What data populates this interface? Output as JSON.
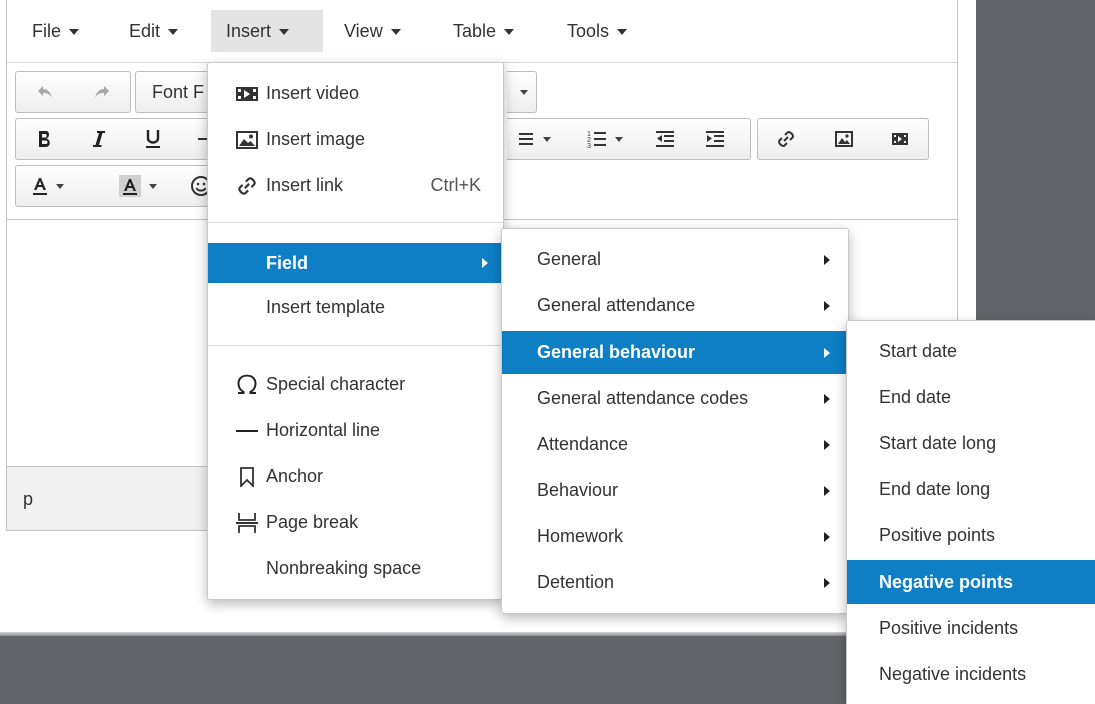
{
  "menubar": {
    "items": [
      {
        "label": "File"
      },
      {
        "label": "Edit"
      },
      {
        "label": "Insert"
      },
      {
        "label": "View"
      },
      {
        "label": "Table"
      },
      {
        "label": "Tools"
      }
    ]
  },
  "toolbar": {
    "font_label": "Font F"
  },
  "statusbar": {
    "path": "p"
  },
  "insert_menu": {
    "items": [
      {
        "label": "Insert video",
        "icon": "video-icon"
      },
      {
        "label": "Insert image",
        "icon": "image-icon"
      },
      {
        "label": "Insert link",
        "icon": "link-icon",
        "shortcut": "Ctrl+K"
      },
      {
        "label": "Field",
        "highlighted": true,
        "submenu": true
      },
      {
        "label": "Insert template"
      },
      {
        "label": "Special character",
        "icon": "omega-icon"
      },
      {
        "label": "Horizontal line",
        "icon": "hr-icon"
      },
      {
        "label": "Anchor",
        "icon": "bookmark-icon"
      },
      {
        "label": "Page break",
        "icon": "page-break-icon"
      },
      {
        "label": "Nonbreaking space"
      }
    ]
  },
  "field_menu": {
    "items": [
      {
        "label": "General"
      },
      {
        "label": "General attendance"
      },
      {
        "label": "General behaviour",
        "highlighted": true
      },
      {
        "label": "General attendance codes"
      },
      {
        "label": "Attendance"
      },
      {
        "label": "Behaviour"
      },
      {
        "label": "Homework"
      },
      {
        "label": "Detention"
      }
    ]
  },
  "behaviour_menu": {
    "items": [
      {
        "label": "Start date"
      },
      {
        "label": "End date"
      },
      {
        "label": "Start date long"
      },
      {
        "label": "End date long"
      },
      {
        "label": "Positive points"
      },
      {
        "label": "Negative points",
        "highlighted": true
      },
      {
        "label": "Positive incidents"
      },
      {
        "label": "Negative incidents"
      }
    ]
  },
  "colors": {
    "highlight": "#0e7ec5",
    "backdrop": "#636469"
  }
}
